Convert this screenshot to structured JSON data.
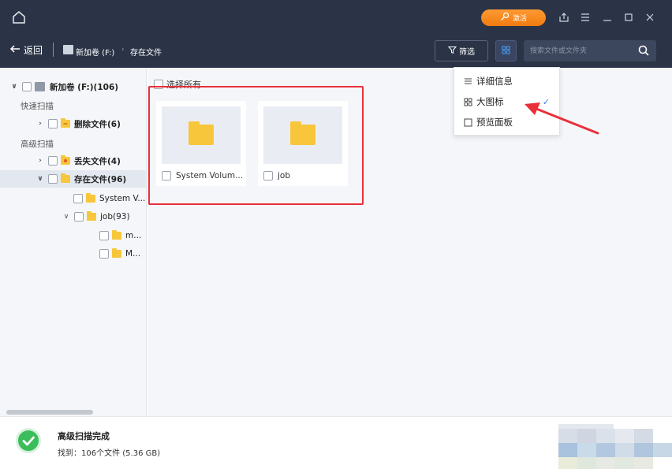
{
  "window": {
    "activate_label": "激活",
    "controls": [
      "share-icon",
      "menu-icon",
      "minimize-icon",
      "maximize-icon",
      "close-icon"
    ]
  },
  "toolbar": {
    "back_label": "返回",
    "breadcrumb": [
      {
        "label": "新加卷 (F:)"
      },
      {
        "label": "存在文件"
      }
    ],
    "filter_label": "筛选",
    "search_placeholder": "搜索文件或文件夹"
  },
  "sidebar": {
    "drive": {
      "label": "新加卷 (F:)(106)",
      "expanded": true
    },
    "quick_scan_label": "快速扫描",
    "quick_scan_items": [
      {
        "label": "删除文件(6)",
        "icon": "deleted-folder-icon"
      }
    ],
    "advanced_scan_label": "高级扫描",
    "advanced_scan_items": [
      {
        "label": "丢失文件(4)",
        "icon": "lost-folder-icon"
      },
      {
        "label": "存在文件(96)",
        "icon": "existing-folder-icon",
        "selected": true
      }
    ],
    "existing_children": [
      {
        "label": "System V..."
      },
      {
        "label": "job(93)",
        "expanded": true
      }
    ],
    "job_children": [
      {
        "label": "m..."
      },
      {
        "label": "M..."
      }
    ]
  },
  "content": {
    "select_all_label": "选择所有",
    "items": [
      {
        "name": "System Volum..."
      },
      {
        "name": "job"
      }
    ]
  },
  "view_menu": {
    "items": [
      {
        "label": "详细信息",
        "icon": "list-icon",
        "checked": false
      },
      {
        "label": "大图标",
        "icon": "grid-icon",
        "checked": true
      },
      {
        "label": "预览面板",
        "icon": "panel-icon",
        "checked": false
      }
    ]
  },
  "status": {
    "title": "高级扫描完成",
    "detail": "找到：106个文件 (5.36 GB)"
  },
  "colors": {
    "topbar": "#2b3447",
    "accent_orange": "#f07b10",
    "annotation_red": "#e8303a",
    "folder_yellow": "#f7c63b",
    "success_green": "#3bbd5b",
    "check_blue": "#2f7bf2"
  }
}
